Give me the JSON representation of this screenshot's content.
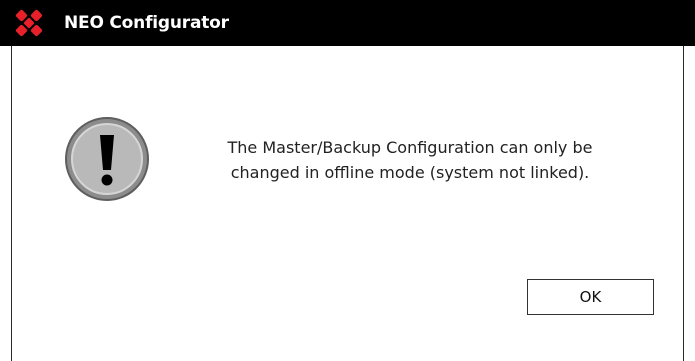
{
  "window": {
    "title": "NEO Configurator",
    "logo_icon": "neo-logo-icon",
    "logo_color": "#e8202a",
    "title_bar_color": "#000000"
  },
  "dialog": {
    "icon": "exclamation-warning-icon",
    "message_line1": "The Master/Backup Configuration can only be",
    "message_line2": "changed in offline mode (system not linked).",
    "ok_label": "OK"
  }
}
